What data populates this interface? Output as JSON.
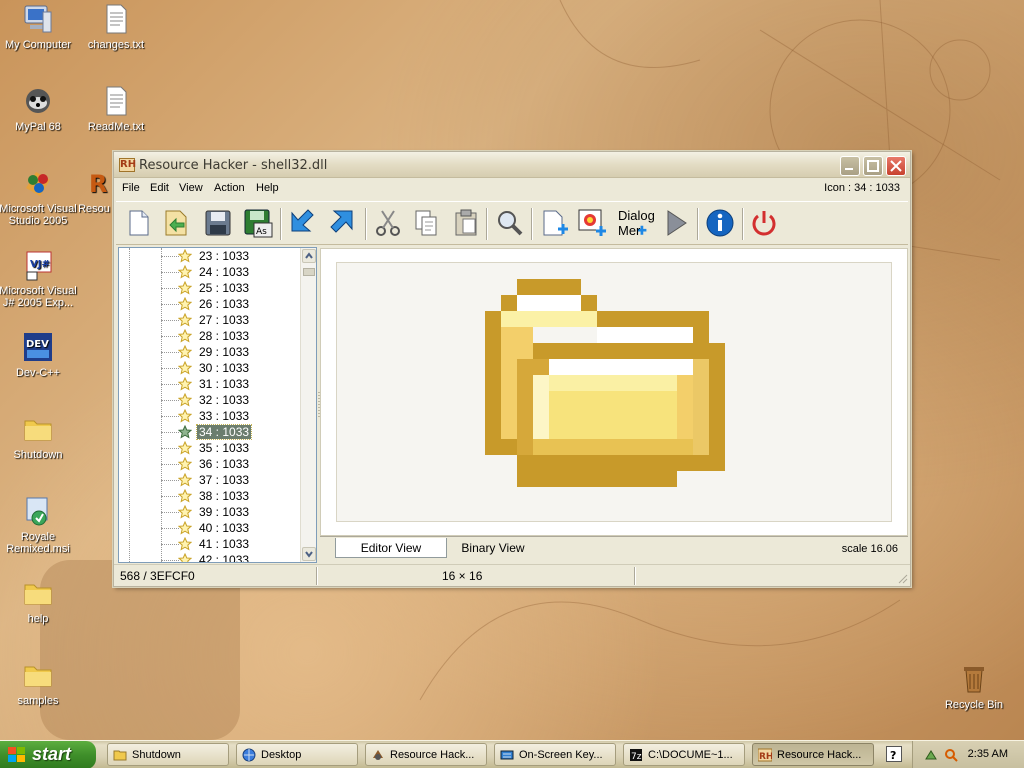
{
  "desktop": {
    "icons": [
      {
        "label": "My Computer"
      },
      {
        "label": "changes.txt"
      },
      {
        "label": "MyPal 68"
      },
      {
        "label": "ReadMe.txt"
      },
      {
        "label": "Microsoft Visual Studio 2005"
      },
      {
        "label": "Resou"
      },
      {
        "label": "Microsoft Visual J# 2005 Exp..."
      },
      {
        "label": "Dev-C++"
      },
      {
        "label": "Shutdown"
      },
      {
        "label": "Royale Remixed.msi"
      },
      {
        "label": "help"
      },
      {
        "label": "samples"
      },
      {
        "label": "Recycle Bin"
      }
    ]
  },
  "window": {
    "app_icon": "RH",
    "title": "Resource Hacker - shell32.dll",
    "menu": [
      "File",
      "Edit",
      "View",
      "Action",
      "Help"
    ],
    "icon_info": "Icon : 34 : 1033",
    "toolbar": {
      "dialog_menu_label": "Dialog Mer",
      "tools": [
        "new-file-icon",
        "open-file-icon",
        "save-icon",
        "save-as-icon",
        "back-arrow-icon",
        "forward-arrow-icon",
        "cut-icon",
        "copy-icon",
        "paste-icon",
        "search-icon",
        "add-resource-icon",
        "add-image-icon",
        "dialog-menu-icon",
        "run-icon",
        "info-icon",
        "power-icon"
      ]
    },
    "tree": {
      "items": [
        "23 : 1033",
        "24 : 1033",
        "25 : 1033",
        "26 : 1033",
        "27 : 1033",
        "28 : 1033",
        "29 : 1033",
        "30 : 1033",
        "31 : 1033",
        "32 : 1033",
        "33 : 1033",
        "34 : 1033",
        "35 : 1033",
        "36 : 1033",
        "37 : 1033",
        "38 : 1033",
        "39 : 1033",
        "40 : 1033",
        "41 : 1033",
        "42 : 1033"
      ],
      "selected": "34 : 1033"
    },
    "tabs": [
      "Editor View",
      "Binary View"
    ],
    "active_tab": "Editor View",
    "scale": "scale 16.06",
    "status": {
      "offset": "568 / 3EFCF0",
      "size": "16 × 16"
    }
  },
  "taskbar": {
    "start_label": "start",
    "tasks": [
      {
        "label": "Shutdown",
        "icon": "folder-icon"
      },
      {
        "label": "Desktop",
        "icon": "browser-icon"
      },
      {
        "label": "Resource Hack...",
        "icon": "app-icon"
      },
      {
        "label": "On-Screen Key...",
        "icon": "keyboard-icon"
      },
      {
        "label": "C:\\DOCUME~1...",
        "icon": "7zip-icon"
      },
      {
        "label": "Resource Hack...",
        "icon": "rh-icon"
      }
    ],
    "clock": "2:35 AM"
  }
}
